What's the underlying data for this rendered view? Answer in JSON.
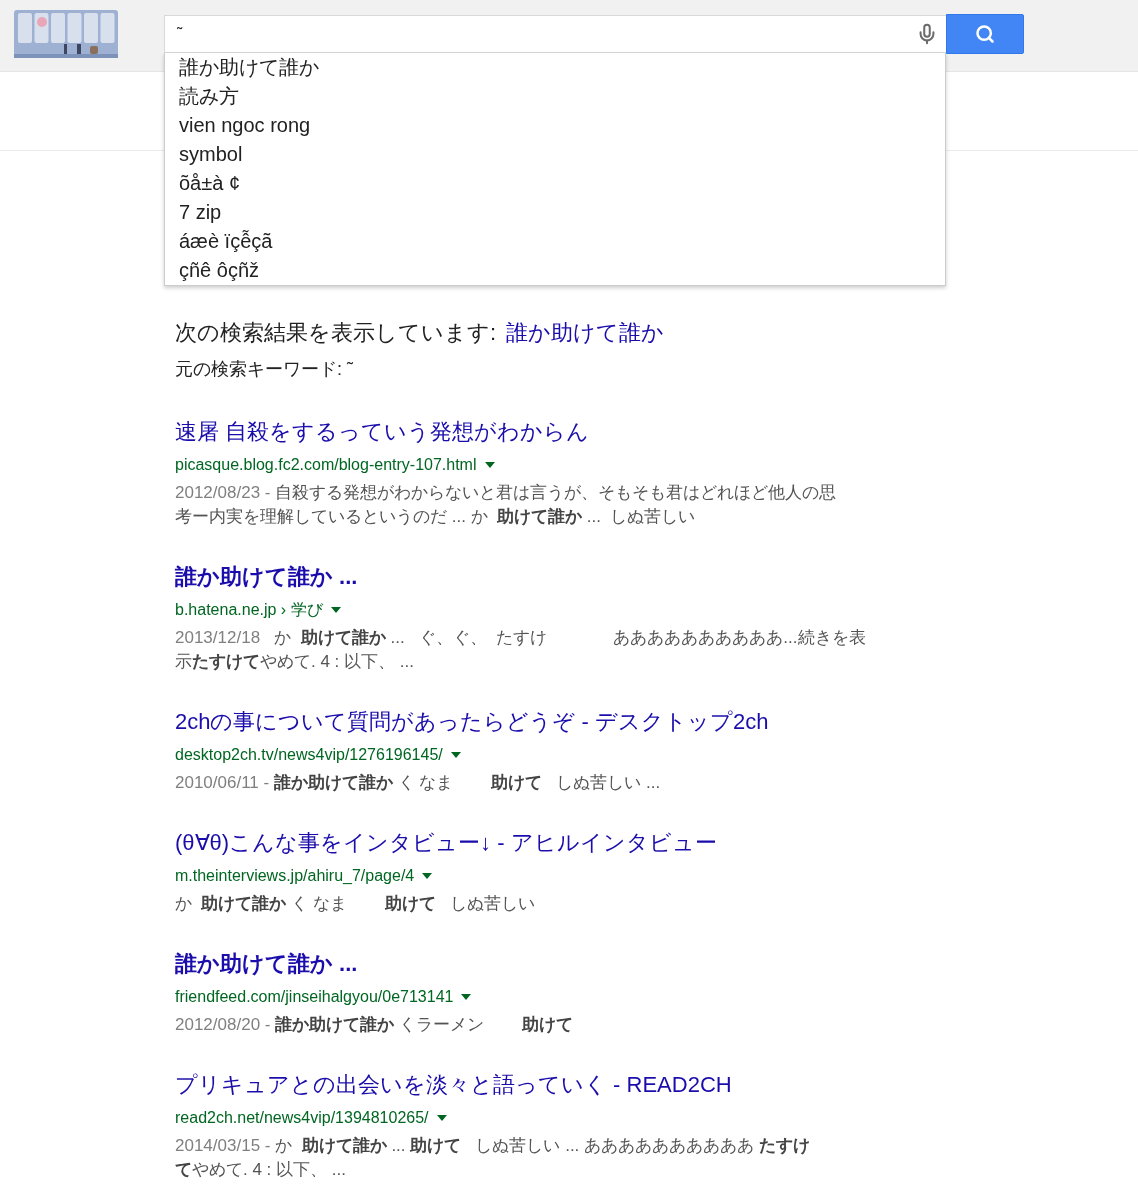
{
  "search": {
    "query": "˜"
  },
  "suggestions": [
    "誰か助けて誰か",
    "読み方",
    "vien ngoc rong",
    "symbol",
    "õå±à ¢",
    "7 zip",
    "áæè ïçễçã",
    "çñê ôçñž"
  ],
  "notice": {
    "showing_label": "次の検索結果を表示しています:",
    "corrected_query": "誰か助けて誰か",
    "original_label": "元の検索キーワード:",
    "original_query": "˜"
  },
  "results": [
    {
      "title": "速屠 自殺をするっていう発想がわからん",
      "bold": false,
      "url": "picasque.blog.fc2.com/blog-entry-107.html",
      "date": "2012/08/23 -",
      "snippet": [
        "自殺する発想がわからないと君は言うが、そもそも君はどれほど他人の思",
        "考ー内実を理解しているというのだ ... か  **助けて誰か** ...  しぬ苦しい"
      ]
    },
    {
      "title": "誰か助けて誰か ...",
      "bold": true,
      "url": "b.hatena.ne.jp › 学び",
      "date": "2013/12/18",
      "snippet": [
        "  か  **助けて誰か** ...   ぐ、ぐ、  たすけ              ああああああああああ...続きを表",
        "示**たすけて**やめて. 4 : 以下、 ..."
      ]
    },
    {
      "title": "2chの事について質問があったらどうぞ - デスクトップ2ch",
      "bold": false,
      "url": "desktop2ch.tv/news4vip/1276196145/",
      "date": "2010/06/11 -",
      "snippet": [
        "**誰か助けて誰か** く なま        **助けて**   しぬ苦しい ..."
      ]
    },
    {
      "title": "(θ∀θ)こんな事をインタビュー↓ - アヒルインタビュー",
      "bold": false,
      "url": "m.theinterviews.jp/ahiru_7/page/4",
      "snippet": [
        "か  **助けて誰か** く なま        **助けて**   しぬ苦しい"
      ]
    },
    {
      "title": "誰か助けて誰か ...",
      "bold": true,
      "url": "friendfeed.com/jinseihalgyou/0e713141",
      "date": "2012/08/20 -",
      "snippet": [
        "**誰か助けて誰か** くラーメン        **助けて**"
      ]
    },
    {
      "title": "プリキュアとの出会いを淡々と語っていく - READ2CH",
      "bold": false,
      "url": "read2ch.net/news4vip/1394810265/",
      "date": "2014/03/15 -",
      "snippet": [
        "か  **助けて誰か** ... **助けて**   しぬ苦しい ... ああああああああああ **たすけ**",
        "**て**やめて. 4 : 以下、 ..."
      ]
    }
  ]
}
